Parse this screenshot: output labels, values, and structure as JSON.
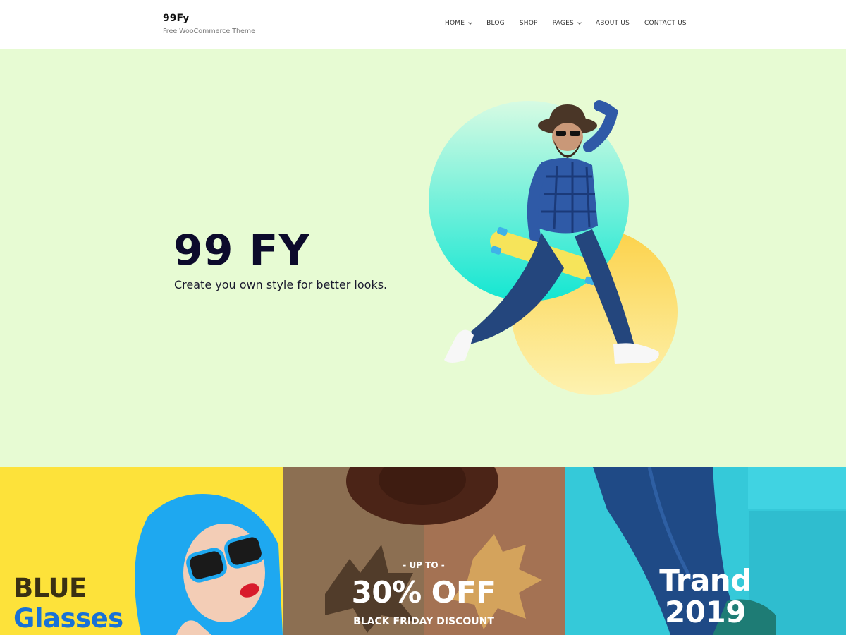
{
  "header": {
    "site_title": "99Fy",
    "tagline": "Free WooCommerce Theme",
    "nav": [
      {
        "label": "HOME",
        "has_dropdown": true
      },
      {
        "label": "BLOG",
        "has_dropdown": false
      },
      {
        "label": "SHOP",
        "has_dropdown": false
      },
      {
        "label": "PAGES",
        "has_dropdown": true
      },
      {
        "label": "ABOUT US",
        "has_dropdown": false
      },
      {
        "label": "CONTACT US",
        "has_dropdown": false
      }
    ]
  },
  "hero": {
    "heading": "99 FY",
    "subheading": "Create you own style for better looks.",
    "background_color": "#e7fbd3"
  },
  "promos": [
    {
      "line1": "BLUE",
      "line2": "Glasses",
      "background_color": "#fde23a"
    },
    {
      "kicker": "- UP TO -",
      "headline": "30% OFF",
      "footer": "BLACK FRIDAY DISCOUNT",
      "background_color": "#8c6b4d"
    },
    {
      "line1": "Trand",
      "line2": "2019",
      "background_color": "#35c9d9"
    }
  ]
}
